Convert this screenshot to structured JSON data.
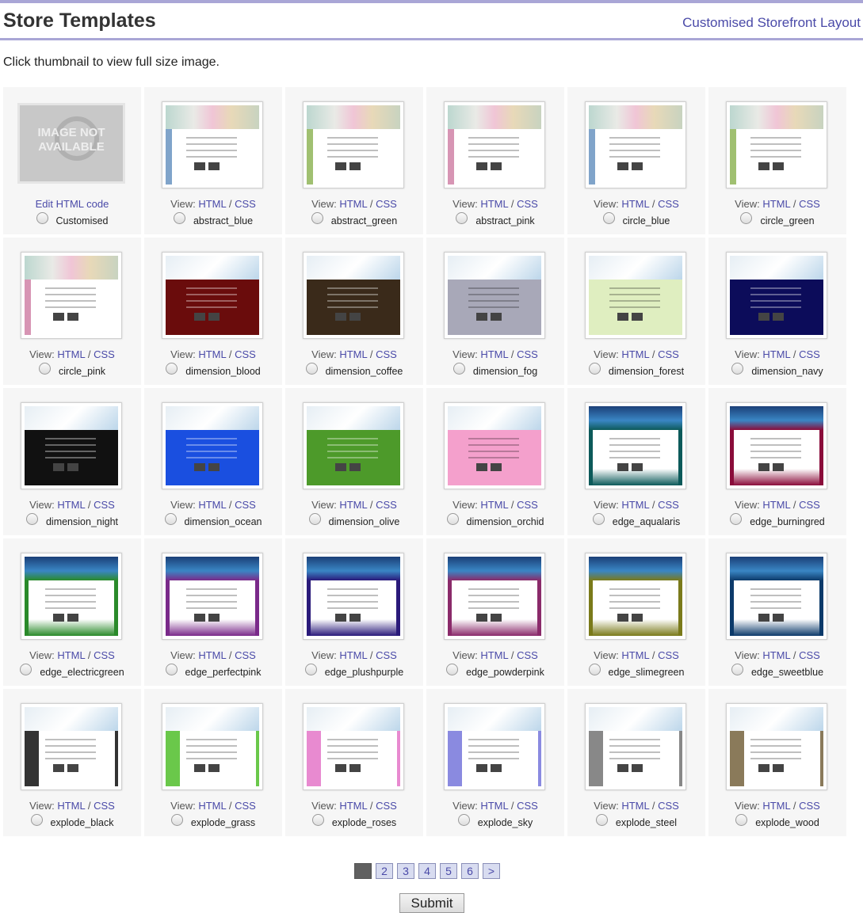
{
  "header": {
    "title": "Store Templates",
    "link": "Customised Storefront Layout"
  },
  "intro": "Click thumbnail to view full size image.",
  "view_prefix": "View:",
  "html_label": "HTML",
  "separator": "/",
  "css_label": "CSS",
  "not_available_text": "IMAGE NOT AVAILABLE",
  "edit_label": "Edit HTML code",
  "templates": [
    {
      "name": "Customised",
      "style": "none"
    },
    {
      "name": "abstract_blue",
      "style": "abstract",
      "accent": "#7aa0c8"
    },
    {
      "name": "abstract_green",
      "style": "abstract",
      "accent": "#9bbd6a"
    },
    {
      "name": "abstract_pink",
      "style": "abstract",
      "accent": "#d590b0"
    },
    {
      "name": "circle_blue",
      "style": "abstract",
      "accent": "#7aa0c8"
    },
    {
      "name": "circle_green",
      "style": "abstract",
      "accent": "#9bbd6a"
    },
    {
      "name": "circle_pink",
      "style": "abstract",
      "accent": "#d590b0"
    },
    {
      "name": "dimension_blood",
      "style": "dimension",
      "bg": "#6a0c0c"
    },
    {
      "name": "dimension_coffee",
      "style": "dimension",
      "bg": "#3a2a1a"
    },
    {
      "name": "dimension_fog",
      "style": "dimension",
      "bg": "#a8a8b8"
    },
    {
      "name": "dimension_forest",
      "style": "dimension",
      "bg": "#dfeec0"
    },
    {
      "name": "dimension_navy",
      "style": "dimension",
      "bg": "#0c0c5a"
    },
    {
      "name": "dimension_night",
      "style": "dimension",
      "bg": "#111111"
    },
    {
      "name": "dimension_ocean",
      "style": "dimension",
      "bg": "#1a4fe0"
    },
    {
      "name": "dimension_olive",
      "style": "dimension",
      "bg": "#4d9a2a"
    },
    {
      "name": "dimension_orchid",
      "style": "dimension",
      "bg": "#f4a0cc"
    },
    {
      "name": "edge_aqualaris",
      "style": "edge",
      "bg": "#0c5a5a"
    },
    {
      "name": "edge_burningred",
      "style": "edge",
      "bg": "#8a0c3a"
    },
    {
      "name": "edge_electricgreen",
      "style": "edge",
      "bg": "#2a8a2a"
    },
    {
      "name": "edge_perfectpink",
      "style": "edge",
      "bg": "#7a2a8a"
    },
    {
      "name": "edge_plushpurple",
      "style": "edge",
      "bg": "#2a1a7a"
    },
    {
      "name": "edge_powderpink",
      "style": "edge",
      "bg": "#8a2a6a"
    },
    {
      "name": "edge_slimegreen",
      "style": "edge",
      "bg": "#7a7a1a"
    },
    {
      "name": "edge_sweetblue",
      "style": "edge",
      "bg": "#0c3a6a"
    },
    {
      "name": "explode_black",
      "style": "explode",
      "accent": "#333333"
    },
    {
      "name": "explode_grass",
      "style": "explode",
      "accent": "#6ac84a"
    },
    {
      "name": "explode_roses",
      "style": "explode",
      "accent": "#e88ad0"
    },
    {
      "name": "explode_sky",
      "style": "explode",
      "accent": "#8a8ae0"
    },
    {
      "name": "explode_steel",
      "style": "explode",
      "accent": "#888888"
    },
    {
      "name": "explode_wood",
      "style": "explode",
      "accent": "#8a7a5a"
    }
  ],
  "pager": {
    "pages": [
      "1",
      "2",
      "3",
      "4",
      "5",
      "6"
    ],
    "next": ">",
    "current": "1"
  },
  "submit_label": "Submit"
}
